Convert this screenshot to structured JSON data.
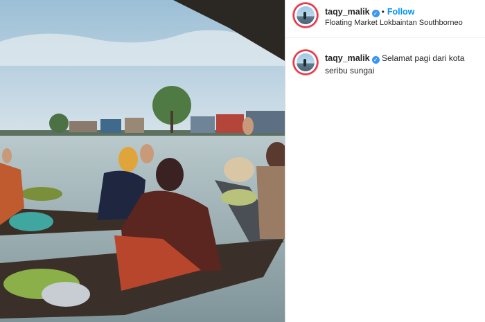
{
  "post": {
    "username": "taqy_malik",
    "verified_icon": "verified-badge-icon",
    "separator": "•",
    "follow_label": "Follow",
    "location": "Floating Market Lokbaintan Southborneo",
    "caption": "Selamat pagi dari kota seribu sungai"
  },
  "colors": {
    "follow": "#0095f6",
    "verified": "#3897f0",
    "text": "#262626",
    "border": "#dbdbdb"
  }
}
